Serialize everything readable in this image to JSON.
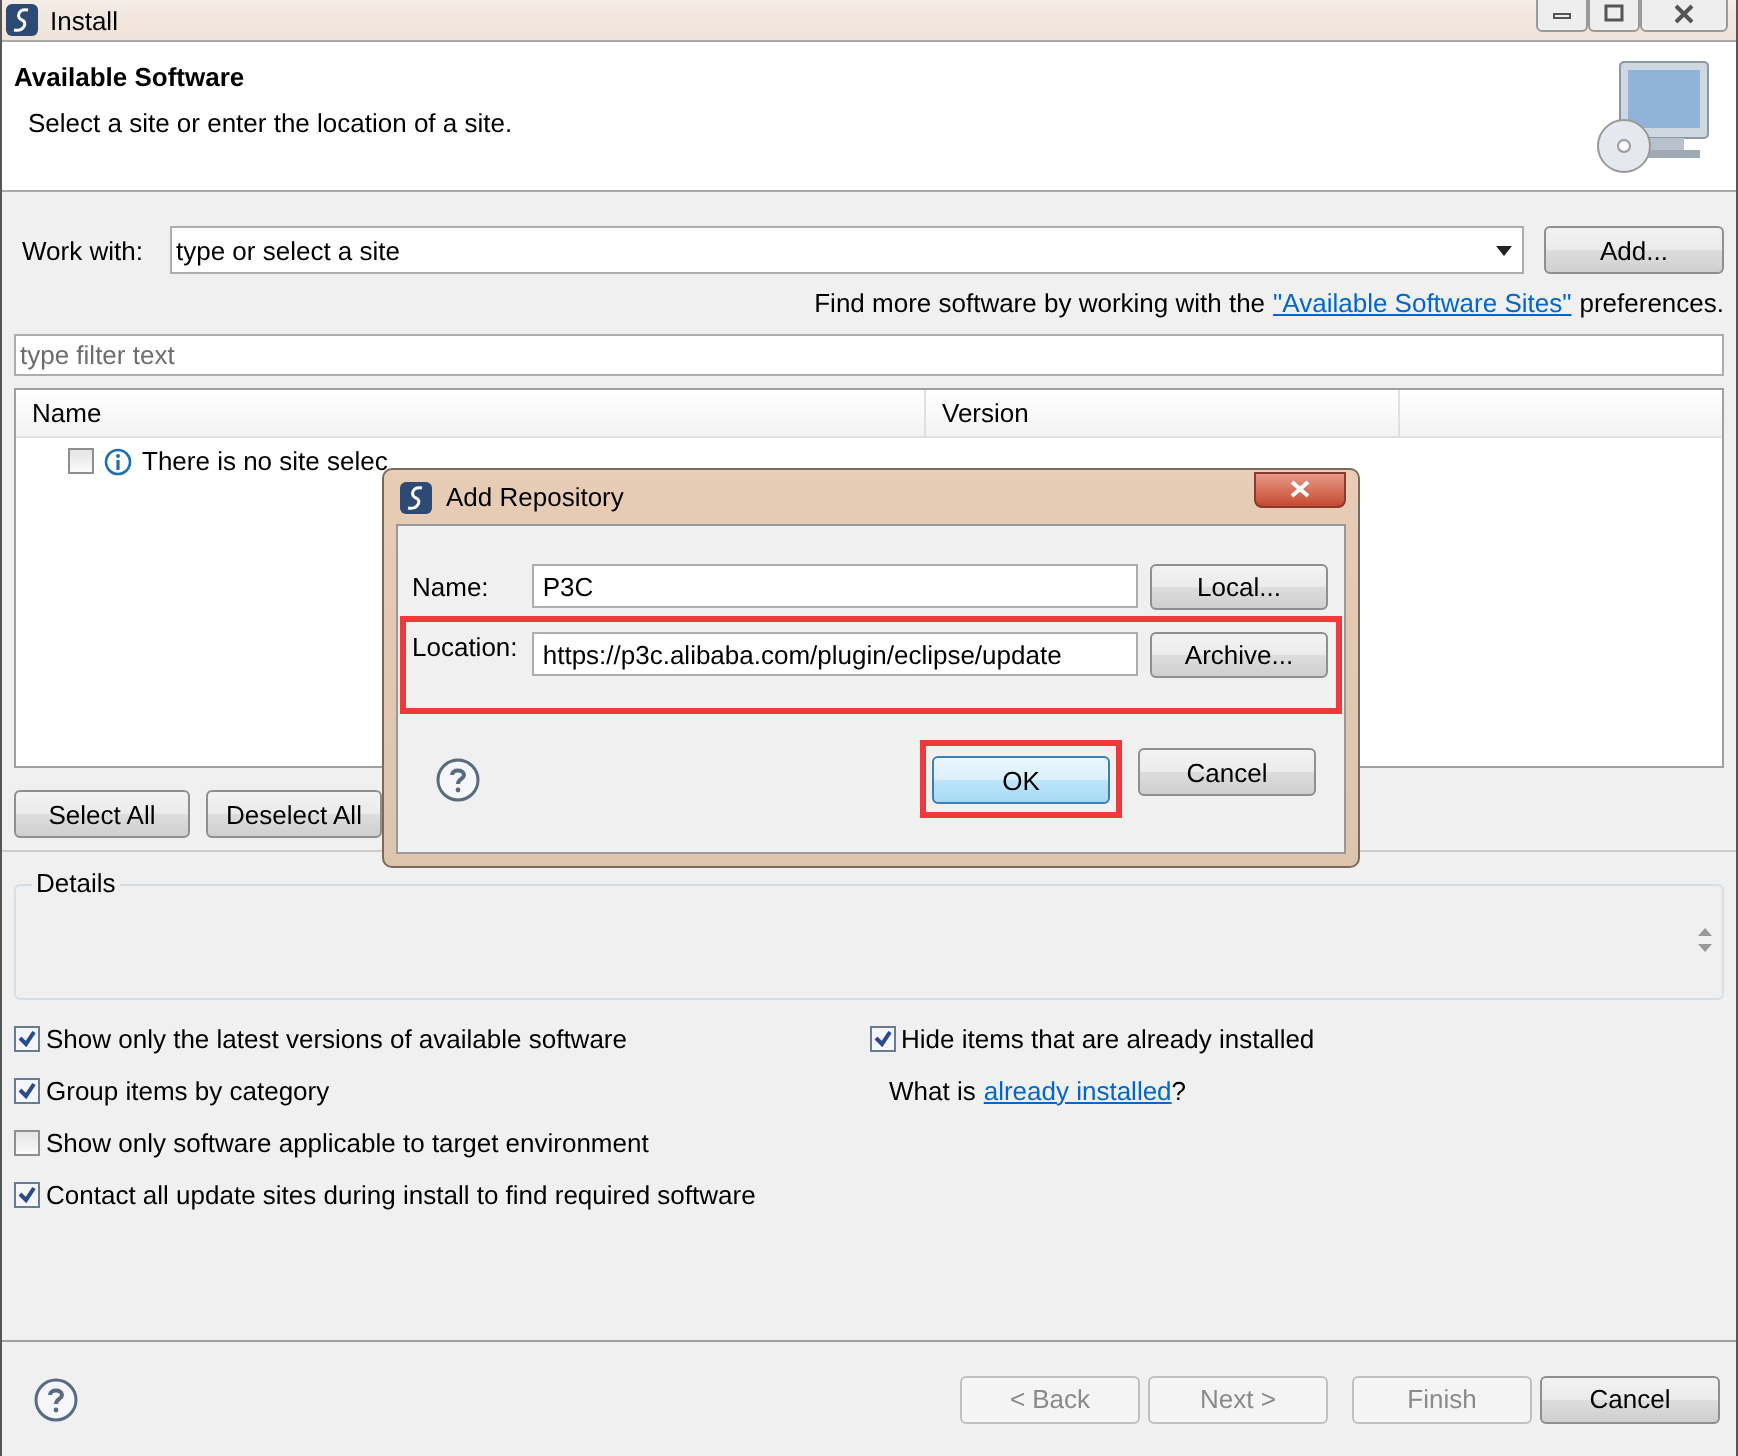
{
  "window": {
    "title": "Install"
  },
  "header": {
    "title": "Available Software",
    "subtitle": "Select a site or enter the location of a site."
  },
  "work_with": {
    "label": "Work with:",
    "placeholder": "type or select a site",
    "button": "Add..."
  },
  "hint": {
    "prefix": "Find more software by working with the",
    "link": "\"Available Software Sites\"",
    "suffix": "preferences."
  },
  "filter": {
    "placeholder": "type filter text"
  },
  "table": {
    "columns": [
      "Name",
      "Version"
    ],
    "rows": [
      {
        "checked": false,
        "name": "There is no site selec"
      }
    ]
  },
  "table_buttons": [
    "Select All",
    "Deselect All"
  ],
  "details": {
    "title": "Details"
  },
  "options_left": [
    {
      "label": "Show only the latest versions of available software",
      "checked": true
    },
    {
      "label": "Group items by category",
      "checked": true
    },
    {
      "label": "Show only software applicable to target environment",
      "checked": false
    },
    {
      "label": "Contact all update sites during install to find required software",
      "checked": true
    }
  ],
  "options_right": {
    "label": "Hide items that are already installed",
    "checked": true,
    "prefix": "What is",
    "link": "already installed",
    "suffix": "?"
  },
  "footer": [
    {
      "label": "< Back",
      "disabled": true
    },
    {
      "label": "Next >",
      "disabled": true
    },
    {
      "label": "Finish",
      "disabled": true
    },
    {
      "label": "Cancel",
      "disabled": false
    }
  ],
  "dialog": {
    "title": "Add Repository",
    "fields": [
      {
        "label": "Name:",
        "value": "P3C",
        "button": "Local...",
        "highlighted": false
      },
      {
        "label": "Location:",
        "value": "https://p3c.alibaba.com/plugin/eclipse/update",
        "button": "Archive...",
        "highlighted": true
      }
    ],
    "buttons": [
      {
        "label": "OK",
        "default": true,
        "highlighted": true
      },
      {
        "label": "Cancel",
        "default": false,
        "highlighted": false
      }
    ]
  }
}
